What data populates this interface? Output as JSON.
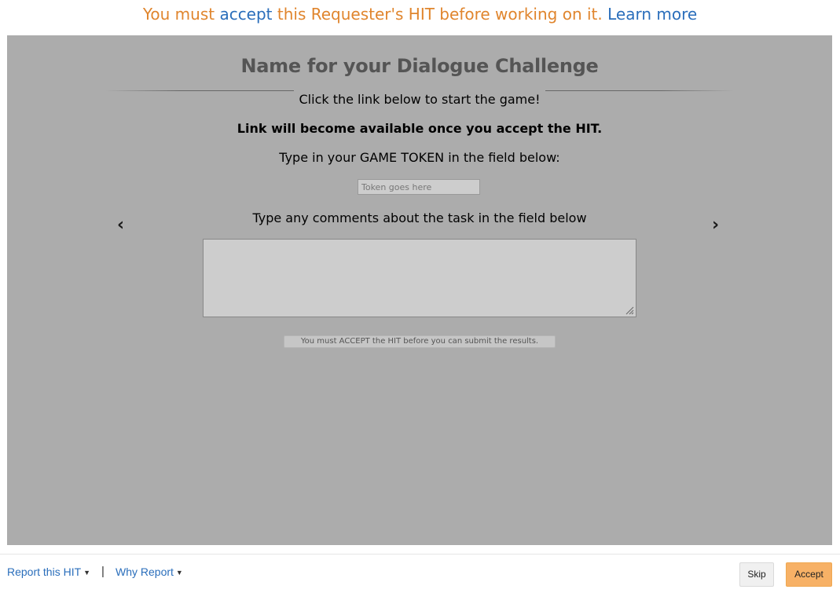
{
  "banner": {
    "prefix": "You must ",
    "accept_link": "accept",
    "middle": " this Requester's HIT before working on it. ",
    "learn_more": "Learn more"
  },
  "hit": {
    "title": "Name for your Dialogue Challenge",
    "line1": "Click the link below to start the game!",
    "line2": "Link will become available once you accept the HIT.",
    "line3": "Type in your GAME TOKEN in the field below:",
    "token_placeholder": "Token goes here",
    "token_value": "",
    "line4": "Type any comments about the task in the field below",
    "comments_value": "",
    "submit_label": "You must ACCEPT the HIT before you can submit the results.",
    "prev_arrow": "‹",
    "next_arrow": "›"
  },
  "footer": {
    "report_label": "Report this HIT",
    "separator": "|",
    "why_report_label": "Why Report",
    "caret": "▼",
    "skip_label": "Skip",
    "accept_label": "Accept"
  },
  "colors": {
    "banner_text": "#e0852d",
    "link": "#2a6ebb",
    "hit_background": "#acacac",
    "accept_button": "#f7b166"
  },
  "icons": {
    "prev": "chevron-left-icon",
    "next": "chevron-right-icon",
    "dropdown": "caret-down-icon",
    "resize": "resize-grip-icon"
  }
}
